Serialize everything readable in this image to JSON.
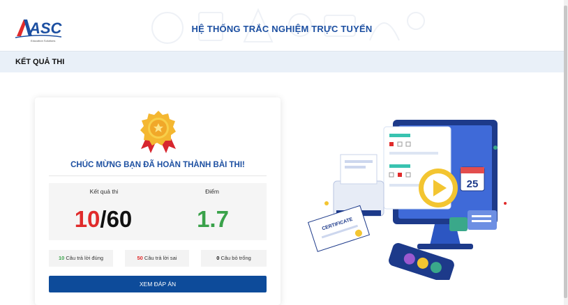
{
  "header": {
    "logo_text": "ASC",
    "logo_sub": "Education Solutions",
    "title": "HỆ THỐNG TRẮC NGHIỆM TRỰC TUYẾN"
  },
  "section": {
    "title": "KẾT QUẢ THI"
  },
  "result": {
    "congrats": "CHÚC MỪNG BẠN ĐÃ HOÀN THÀNH BÀI THI!",
    "result_label": "Kết quả thi",
    "score_label": "Điểm",
    "correct": "10",
    "separator": "/",
    "total": "60",
    "score": "1.7",
    "correct_count": "10",
    "correct_text": " Câu trả lời đúng",
    "wrong_count": "50",
    "wrong_text": " Câu trả lời sai",
    "blank_count": "0",
    "blank_text": " Câu bỏ trống",
    "review_button": "XEM ĐÁP ÁN"
  },
  "illustration": {
    "calendar_day": "25",
    "certificate_text": "CERTIFICATE"
  },
  "colors": {
    "brand_blue": "#1c4fa1",
    "button_blue": "#0d4b9a",
    "correct_green": "#3aa24a",
    "wrong_red": "#e02b2b",
    "section_bg": "#e9f0f8"
  }
}
